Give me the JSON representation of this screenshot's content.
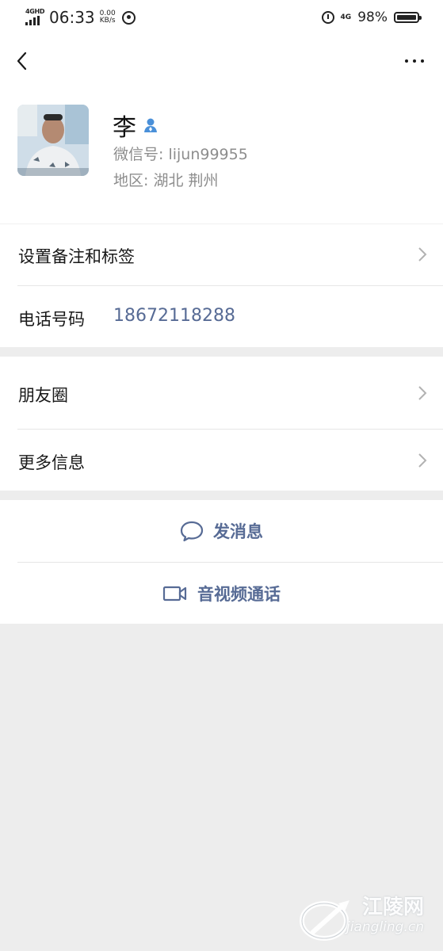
{
  "status_bar": {
    "network_tag": "4GHD",
    "time": "06:33",
    "speed_value": "0.00",
    "speed_unit": "KB/s",
    "network_right": "4G",
    "battery_percent": "98%",
    "battery_level": 0.98
  },
  "contact": {
    "name": "李",
    "wechat_id": "微信号: lijun99955",
    "region": "地区: 湖北  荆州"
  },
  "menu": {
    "remark_tags": "设置备注和标签",
    "phone_label": "电话号码",
    "phone_number": "18672118288",
    "moments": "朋友圈",
    "more_info": "更多信息"
  },
  "actions": {
    "send_message": "发消息",
    "video_call": "音视频通话"
  },
  "watermark": {
    "site_name": "江陵网",
    "url": "jiangling.cn"
  }
}
